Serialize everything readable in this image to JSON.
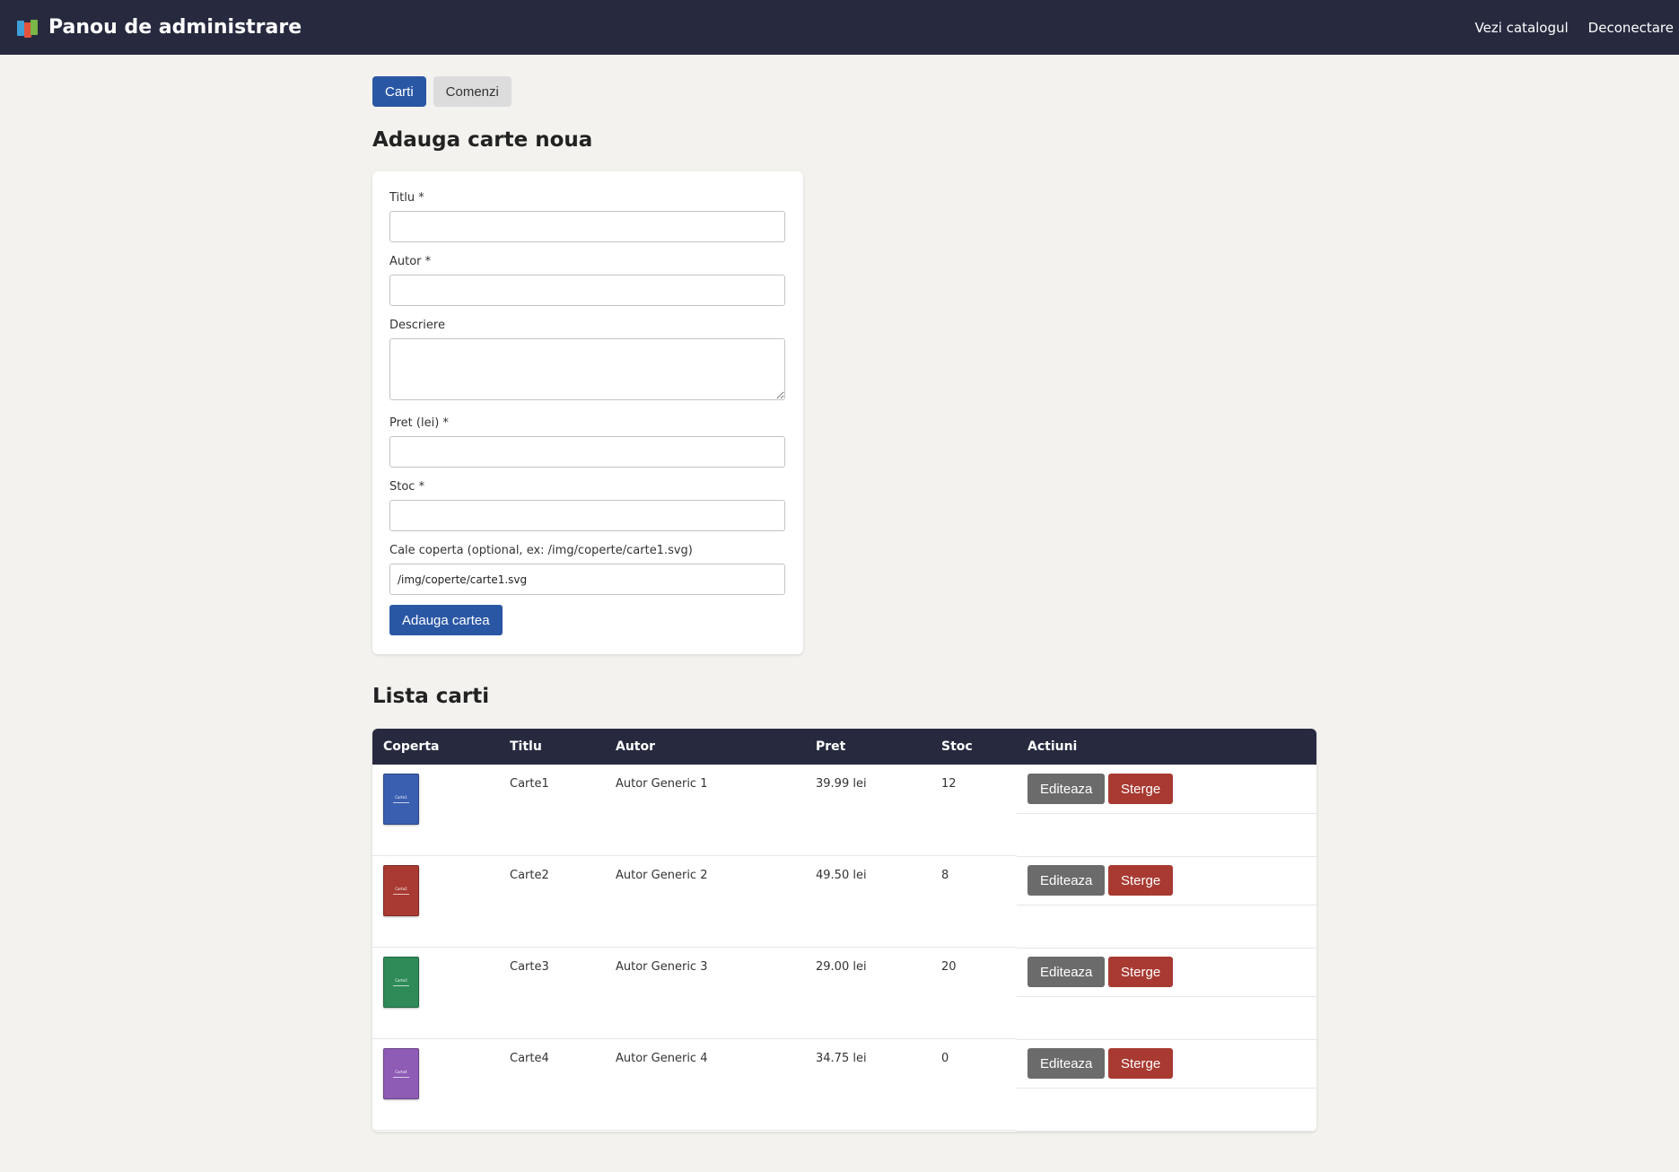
{
  "header": {
    "title": "Panou de administrare",
    "nav": [
      "Vezi catalogul",
      "Deconectare"
    ]
  },
  "tabs": [
    {
      "label": "Carti",
      "active": true
    },
    {
      "label": "Comenzi",
      "active": false
    }
  ],
  "form": {
    "heading": "Adauga carte noua",
    "fields": [
      {
        "label": "Titlu *",
        "value": ""
      },
      {
        "label": "Autor *",
        "value": ""
      },
      {
        "label": "Descriere",
        "value": ""
      },
      {
        "label": "Pret (lei) *",
        "value": ""
      },
      {
        "label": "Stoc *",
        "value": ""
      },
      {
        "label": "Cale coperta (optional, ex: /img/coperte/carte1.svg)",
        "value": "/img/coperte/carte1.svg"
      }
    ],
    "submit_label": "Adauga cartea"
  },
  "list": {
    "heading": "Lista carti",
    "columns": [
      "Coperta",
      "Titlu",
      "Autor",
      "Pret",
      "Stoc",
      "Actiuni"
    ],
    "rows": [
      {
        "title": "Carte1",
        "author": "Autor Generic 1",
        "price": "39.99 lei",
        "stock": "12",
        "cover_color": "#3a5fb0",
        "cover_text": "Carte1"
      },
      {
        "title": "Carte2",
        "author": "Autor Generic 2",
        "price": "49.50 lei",
        "stock": "8",
        "cover_color": "#a83a32",
        "cover_text": "Carte2"
      },
      {
        "title": "Carte3",
        "author": "Autor Generic 3",
        "price": "29.00 lei",
        "stock": "20",
        "cover_color": "#2e8b57",
        "cover_text": "Carte3"
      },
      {
        "title": "Carte4",
        "author": "Autor Generic 4",
        "price": "34.75 lei",
        "stock": "0",
        "cover_color": "#8e5bb5",
        "cover_text": "Carte4"
      }
    ],
    "edit_label": "Editeaza",
    "delete_label": "Sterge"
  }
}
